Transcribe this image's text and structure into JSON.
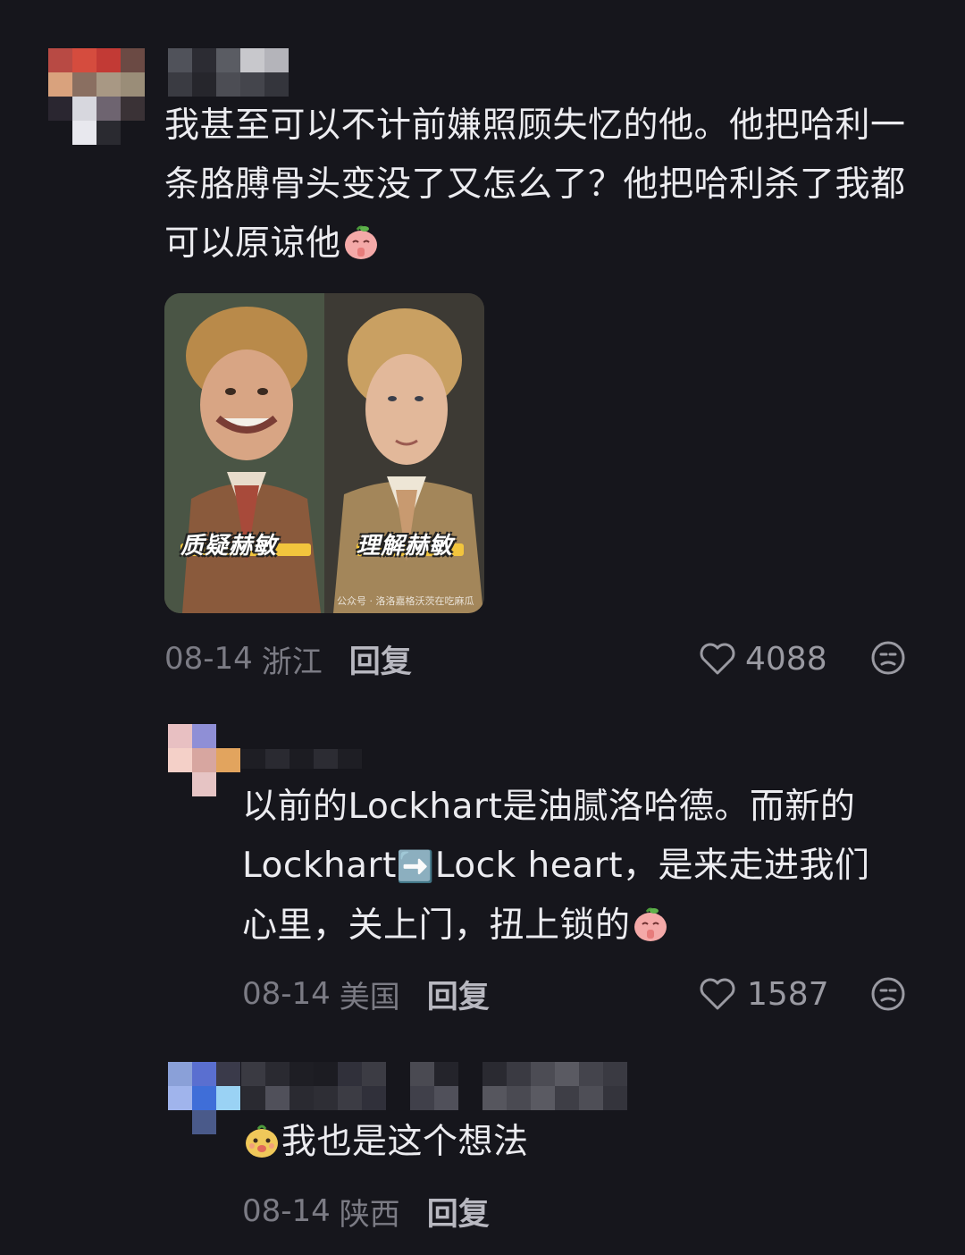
{
  "colors": {
    "background": "#16161c",
    "text": "#ececf0",
    "meta": "#7b7b84",
    "reply": "#b8b8c0"
  },
  "comments": [
    {
      "text": "我甚至可以不计前嫌照顾失忆的他。他把哈利一条胳膊骨头变没了又怎么了？他把哈利杀了我都可以原谅他",
      "emoji": "praying-peach-emoji",
      "image": {
        "left_caption": "质疑赫敏",
        "right_caption": "理解赫敏",
        "watermark": "公众号 · 洛洛嘉格沃茨在吃麻瓜"
      },
      "date": "08-14",
      "location": "浙江",
      "reply_label": "回复",
      "likes": "4088",
      "like_icon": "heart-outline-icon",
      "dislike_icon": "meh-face-icon"
    },
    {
      "text_part1": "以前的Lockhart是油腻洛哈德。而新的Lockhart",
      "arrow_emoji": "➡️",
      "text_part2": "Lock heart，是来走进我们心里，关上门，扭上锁的",
      "emoji": "praying-peach-emoji",
      "date": "08-14",
      "location": "美国",
      "reply_label": "回复",
      "likes": "1587",
      "like_icon": "heart-outline-icon",
      "dislike_icon": "meh-face-icon"
    },
    {
      "emoji": "smiling-potato-emoji",
      "text": "我也是这个想法",
      "date": "08-14",
      "location": "陕西",
      "reply_label": "回复"
    }
  ]
}
